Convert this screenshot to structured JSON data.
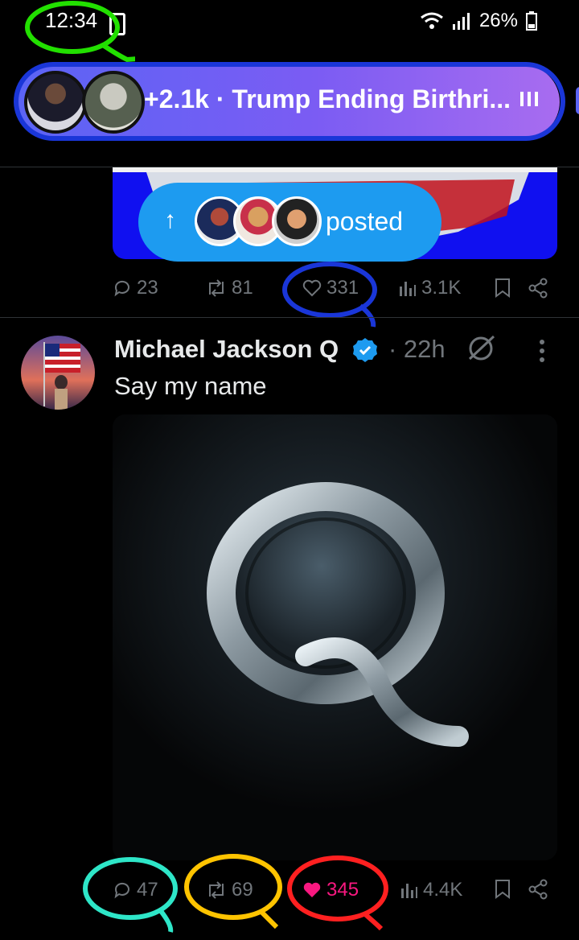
{
  "status_bar": {
    "time": "12:34",
    "battery": "26%"
  },
  "space": {
    "text": "+2.1k · Trump Ending Birthri..."
  },
  "posted_notice": {
    "label": "posted"
  },
  "prev_tweet_actions": {
    "replies": "23",
    "reposts": "81",
    "likes": "331",
    "views": "3.1K"
  },
  "tweet": {
    "author": "Michael Jackson Q",
    "time": "· 22h",
    "text": "Say my name",
    "actions": {
      "replies": "47",
      "reposts": "69",
      "likes": "345",
      "views": "4.4K"
    }
  },
  "colors": {
    "accent": "#1d9bf0",
    "liked": "#f91880",
    "muted": "#71767b",
    "annotation_green": "#22e000",
    "annotation_blue": "#1a36d8",
    "annotation_cyan": "#2ee6c8",
    "annotation_yellow": "#ffc400",
    "annotation_red": "#ff2020"
  },
  "icons": [
    "wifi-icon",
    "signal-icon",
    "battery-icon",
    "verified-icon",
    "grok-icon",
    "more-icon",
    "reply-icon",
    "repost-icon",
    "like-icon",
    "views-icon",
    "bookmark-icon",
    "share-icon",
    "audio-bars-icon",
    "arrow-up-icon"
  ]
}
